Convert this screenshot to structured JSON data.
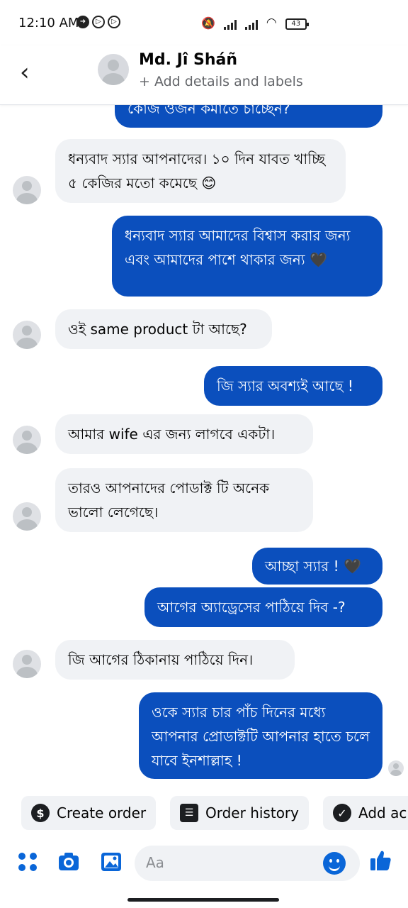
{
  "status_bar": {
    "time": "12:10 AM",
    "battery": "43"
  },
  "header": {
    "contact_name": "Md. Jî Sháñ",
    "subtitle": "+ Add details and labels"
  },
  "messages": [
    {
      "side": "out",
      "text": "কোজ ওজন কমাতে চাচ্ছেন?"
    },
    {
      "side": "in",
      "text": "ধন্যবাদ স্যার আপনাদের। ১০ দিন যাবত খাচ্ছি ৫ কেজির মতো কমেছে 😊"
    },
    {
      "side": "out",
      "text": "ধন্যবাদ স্যার আমাদের বিশ্বাস করার জন্য এবং আমাদের পাশে থাকার জন্য 🖤"
    },
    {
      "side": "in",
      "text": "ওই same product টা আছে?"
    },
    {
      "side": "out",
      "text": "জি স্যার অবশ্যই আছে !"
    },
    {
      "side": "in",
      "text": "আমার wife এর জন্য লাগবে একটা।"
    },
    {
      "side": "in",
      "text": "তারও আপনাদের পোডাক্ট টি অনেক ভালো লেগেছে।"
    },
    {
      "side": "out",
      "text": "আচ্ছা স্যার ! 🖤"
    },
    {
      "side": "out",
      "text": "আগের অ্যাড্রেসের পাঠিয়ে দিব -?"
    },
    {
      "side": "in",
      "text": "জি আগের ঠিকানায় পাঠিয়ে দিন।"
    },
    {
      "side": "out",
      "text": "ওকে স্যার চার পাঁচ দিনের মধ্যে আপনার প্রোডাক্টটি আপনার হাতে চলে যাবে ইনশাল্লাহ !"
    }
  ],
  "quick_actions": [
    {
      "label": "Create order",
      "icon": "dollar-icon"
    },
    {
      "label": "Order history",
      "icon": "receipt-icon"
    },
    {
      "label": "Add ac",
      "icon": "check-circle-icon"
    }
  ],
  "composer": {
    "placeholder": "Aa"
  },
  "colors": {
    "outgoing_bubble": "#0b4fbd",
    "incoming_bubble": "#f0f2f5",
    "accent": "#0a66d8"
  }
}
